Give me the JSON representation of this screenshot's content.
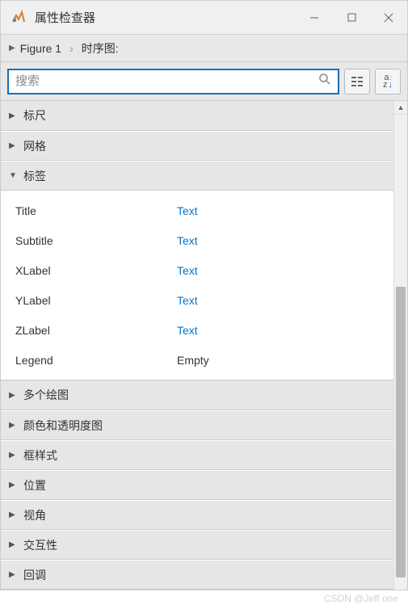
{
  "titlebar": {
    "title": "属性检查器"
  },
  "breadcrumb": {
    "item1": "Figure 1",
    "item2": "时序图:"
  },
  "search": {
    "placeholder": "搜索"
  },
  "sections": {
    "ruler": "标尺",
    "grid": "网格",
    "labels": "标签",
    "multiplots": "多个绘图",
    "colormap": "颜色和透明度图",
    "boxstyle": "框样式",
    "position": "位置",
    "view": "视角",
    "interactivity": "交互性",
    "callbacks": "回调"
  },
  "labelProps": [
    {
      "name": "Title",
      "value": "Text",
      "link": true
    },
    {
      "name": "Subtitle",
      "value": "Text",
      "link": true
    },
    {
      "name": "XLabel",
      "value": "Text",
      "link": true
    },
    {
      "name": "YLabel",
      "value": "Text",
      "link": true
    },
    {
      "name": "ZLabel",
      "value": "Text",
      "link": true
    },
    {
      "name": "Legend",
      "value": "Empty",
      "link": false
    }
  ],
  "watermark": "CSDN @Jeff one"
}
